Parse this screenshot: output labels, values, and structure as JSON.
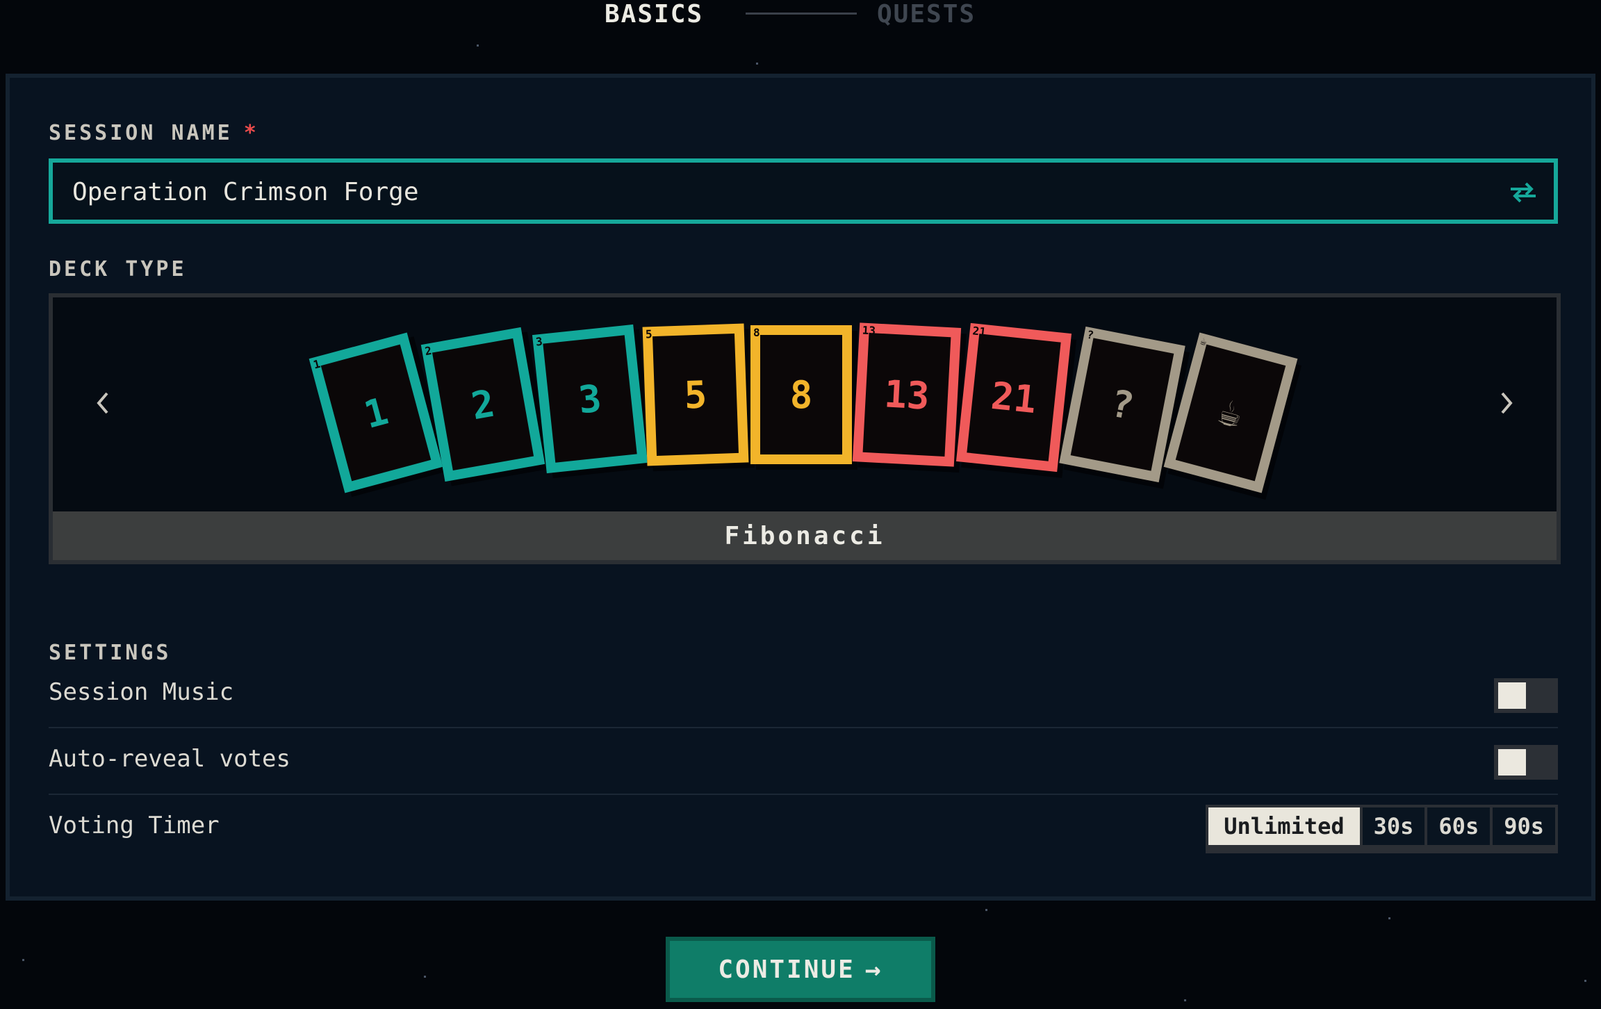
{
  "stepper": {
    "step1": "BASICS",
    "step2": "QUESTS"
  },
  "session_name": {
    "label": "SESSION NAME",
    "required_mark": "*",
    "value": "Operation Crimson Forge",
    "shuffle_icon": "shuffle-icon"
  },
  "deck": {
    "label": "DECK TYPE",
    "name": "Fibonacci",
    "cards": [
      {
        "corner": "1",
        "value": "1",
        "color": "#12a89a"
      },
      {
        "corner": "2",
        "value": "2",
        "color": "#12a89a"
      },
      {
        "corner": "3",
        "value": "3",
        "color": "#12a89a"
      },
      {
        "corner": "5",
        "value": "5",
        "color": "#f2b42a"
      },
      {
        "corner": "8",
        "value": "8",
        "color": "#f2b42a"
      },
      {
        "corner": "13",
        "value": "13",
        "color": "#f05a5a"
      },
      {
        "corner": "21",
        "value": "21",
        "color": "#f05a5a"
      },
      {
        "corner": "?",
        "value": "?",
        "color": "#a39a88"
      },
      {
        "corner": "☕",
        "value": "☕",
        "color": "#a39a88"
      }
    ]
  },
  "settings": {
    "label": "SETTINGS",
    "music": {
      "label": "Session Music",
      "on": false
    },
    "auto_reveal": {
      "label": "Auto-reveal votes",
      "on": false
    },
    "timer": {
      "label": "Voting Timer",
      "options": [
        "Unlimited",
        "30s",
        "60s",
        "90s"
      ],
      "selected": "Unlimited"
    }
  },
  "continue_label": "CONTINUE",
  "continue_arrow": "→",
  "colors": {
    "accent": "#16a89a",
    "panel": "#081320",
    "required": "#e84b4b"
  }
}
